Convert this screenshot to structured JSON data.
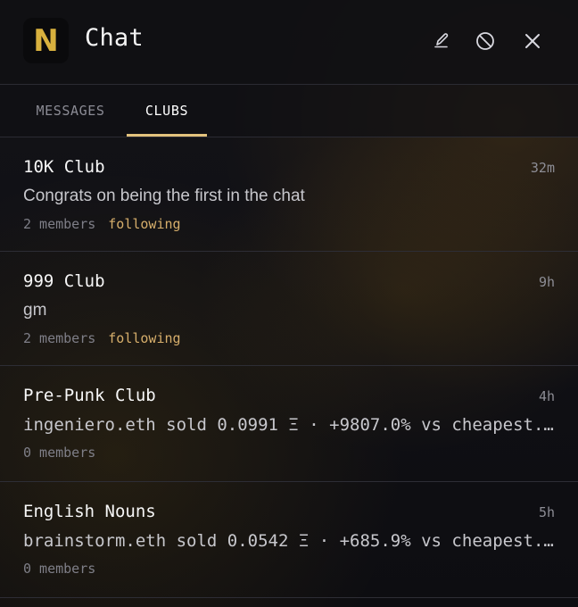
{
  "header": {
    "logo": "N",
    "title": "Chat",
    "icons": [
      "edit-icon",
      "block-icon",
      "close-icon"
    ]
  },
  "tabs": [
    {
      "label": "MESSAGES",
      "active": false
    },
    {
      "label": "CLUBS",
      "active": true
    }
  ],
  "clubs": [
    {
      "name": "10K Club",
      "time": "32m",
      "message": "Congrats on being the first in the chat",
      "members": "2 members",
      "status": "following"
    },
    {
      "name": "999 Club",
      "time": "9h",
      "message": "gm",
      "members": "2 members",
      "status": "following"
    },
    {
      "name": "Pre-Punk Club",
      "time": "4h",
      "message": "ingeniero.eth sold 0.0991 Ξ · +9807.0% vs cheapest...",
      "members": "0 members",
      "status": ""
    },
    {
      "name": "English Nouns",
      "time": "5h",
      "message": "brainstorm.eth sold 0.0542 Ξ · +685.9% vs cheapest...",
      "members": "0 members",
      "status": ""
    }
  ],
  "colors": {
    "accent": "#e2c27d",
    "logo": "#d8b13e",
    "following": "#d6ae6b",
    "background": "#101014"
  }
}
